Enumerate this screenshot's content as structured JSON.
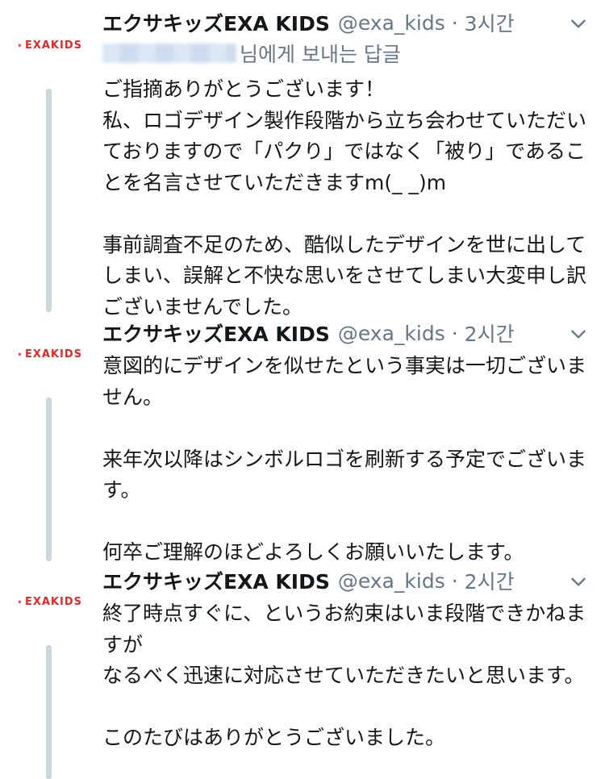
{
  "tweets": [
    {
      "name": "エクサキッズEXA KIDS",
      "handle": "@exa_kids",
      "separator": "·",
      "time": "3시간",
      "reply_to_suffix": "님에게 보내는 답글",
      "avatar_text": "EXAKIDS",
      "text": "ご指摘ありがとうございます！\n私、ロゴデザイン製作段階から立ち会わせていただいておりますので「パクり」ではなく「被り」であることを名言させていただきますm(_ _)m\n\n事前調査不足のため、酷似したデザインを世に出してしまい、誤解と不快な思いをさせてしまい大変申し訳ございませんでした。"
    },
    {
      "name": "エクサキッズEXA KIDS",
      "handle": "@exa_kids",
      "separator": "·",
      "time": "2시간",
      "avatar_text": "EXAKIDS",
      "text": "意図的にデザインを似せたという事実は一切ございません。\n\n来年次以降はシンボルロゴを刷新する予定でございます。\n\n何卒ご理解のほどよろしくお願いいたします。"
    },
    {
      "name": "エクサキッズEXA KIDS",
      "handle": "@exa_kids",
      "separator": "·",
      "time": "2시간",
      "avatar_text": "EXAKIDS",
      "text": "終了時点すぐに、というお約束はいま段階できかねますが\nなるべく迅速に対応させていただきたいと思います。\n\nこのたびはありがとうございました。"
    }
  ],
  "icons": {
    "avatar": "exa-kids-logo-icon",
    "menu": "chevron-down-icon"
  },
  "colors": {
    "brand_red": "#e02a2a",
    "secondary_text": "#657786",
    "thread_line": "#ccd6dd"
  }
}
